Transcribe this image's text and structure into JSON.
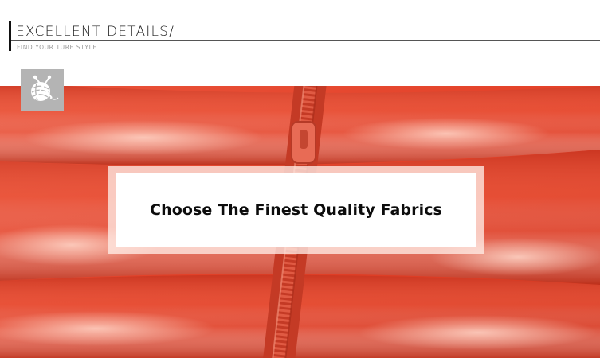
{
  "header": {
    "title": "EXCELLENT  DETAILS/",
    "subtitle": "FIND YOUR TURE STYLE"
  },
  "badge": {
    "icon": "yarn-ball-icon"
  },
  "banner": {
    "text": "Choose The Finest Quality Fabrics"
  },
  "colors": {
    "fabric": "#e4432a",
    "badge": "#b4b4b4",
    "rule": "#555555"
  }
}
